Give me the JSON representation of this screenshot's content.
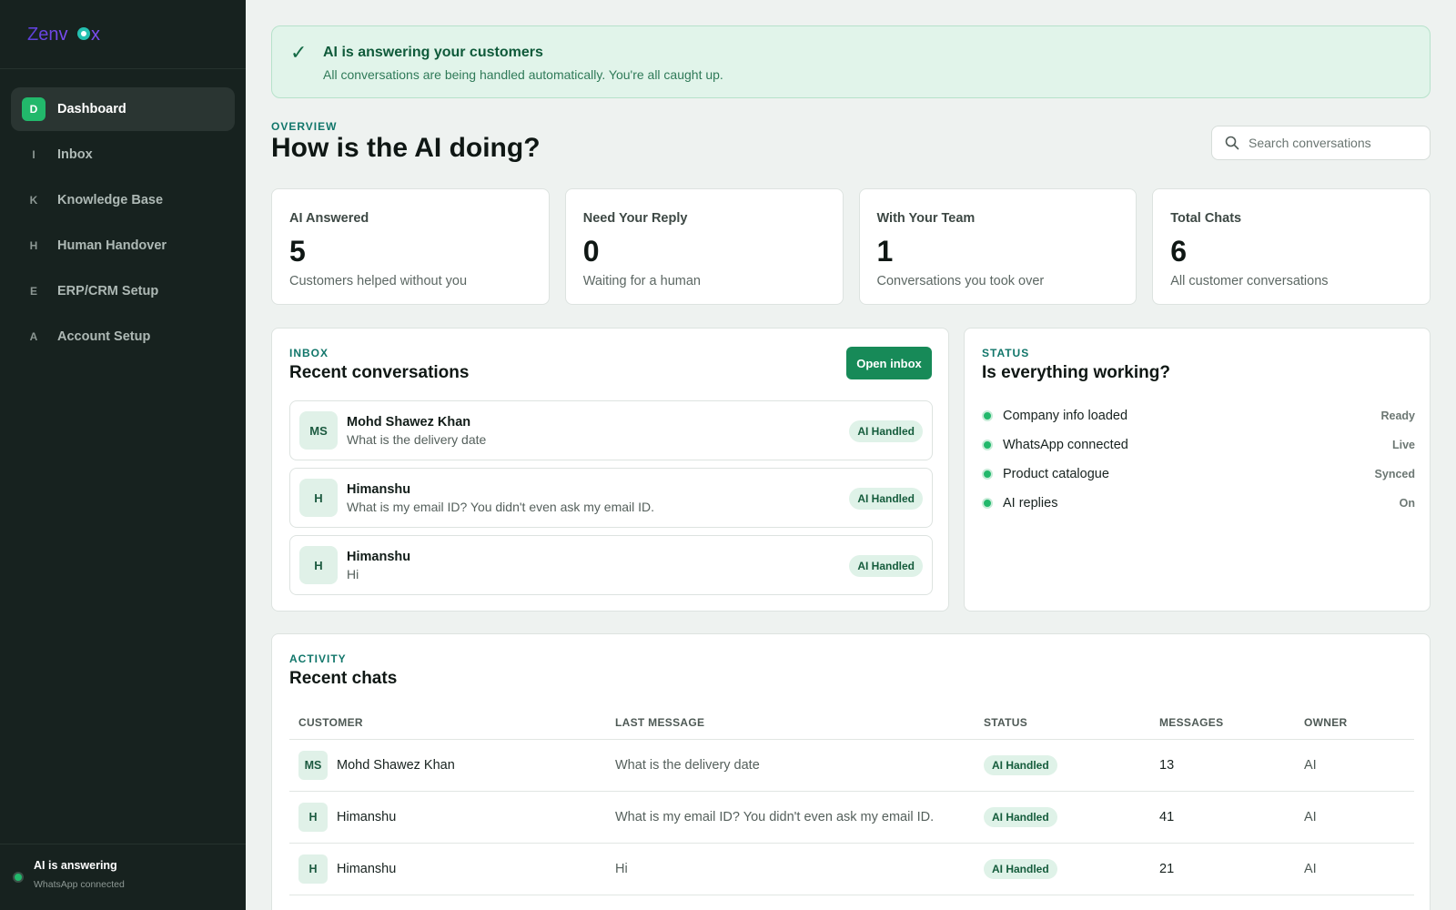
{
  "brand": {
    "name": "Zenvox"
  },
  "sidebar": {
    "items": [
      {
        "badge": "D",
        "label": "Dashboard",
        "active": true
      },
      {
        "badge": "I",
        "label": "Inbox"
      },
      {
        "badge": "K",
        "label": "Knowledge Base"
      },
      {
        "badge": "H",
        "label": "Human Handover"
      },
      {
        "badge": "E",
        "label": "ERP/CRM Setup"
      },
      {
        "badge": "A",
        "label": "Account Setup"
      }
    ],
    "footer": {
      "title": "AI is answering",
      "subtitle": "WhatsApp connected"
    }
  },
  "banner": {
    "icon": "✓",
    "title": "AI is answering your customers",
    "subtitle": "All conversations are being handled automatically. You're all caught up."
  },
  "overview": {
    "eyebrow": "OVERVIEW",
    "title": "How is the AI doing?"
  },
  "search": {
    "placeholder": "Search conversations"
  },
  "stats": [
    {
      "label": "AI Answered",
      "value": "5",
      "desc": "Customers helped without you"
    },
    {
      "label": "Need Your Reply",
      "value": "0",
      "desc": "Waiting for a human"
    },
    {
      "label": "With Your Team",
      "value": "1",
      "desc": "Conversations you took over"
    },
    {
      "label": "Total Chats",
      "value": "6",
      "desc": "All customer conversations"
    }
  ],
  "inbox": {
    "eyebrow": "INBOX",
    "title": "Recent conversations",
    "button": "Open inbox",
    "conversations": [
      {
        "initials": "MS",
        "name": "Mohd Shawez Khan",
        "message": "What is the delivery date",
        "status": "AI Handled"
      },
      {
        "initials": "H",
        "name": "Himanshu",
        "message": "What is my email ID? You didn't even ask my email ID.",
        "status": "AI Handled"
      },
      {
        "initials": "H",
        "name": "Himanshu",
        "message": "Hi",
        "status": "AI Handled"
      }
    ]
  },
  "status": {
    "eyebrow": "STATUS",
    "title": "Is everything working?",
    "items": [
      {
        "label": "Company info loaded",
        "value": "Ready"
      },
      {
        "label": "WhatsApp connected",
        "value": "Live"
      },
      {
        "label": "Product catalogue",
        "value": "Synced"
      },
      {
        "label": "AI replies",
        "value": "On"
      }
    ]
  },
  "activity": {
    "eyebrow": "ACTIVITY",
    "title": "Recent chats",
    "columns": [
      "CUSTOMER",
      "LAST MESSAGE",
      "STATUS",
      "MESSAGES",
      "OWNER"
    ],
    "rows": [
      {
        "initials": "MS",
        "customer": "Mohd Shawez Khan",
        "last_message": "What is the delivery date",
        "status": "AI Handled",
        "messages": "13",
        "owner": "AI"
      },
      {
        "initials": "H",
        "customer": "Himanshu",
        "last_message": "What is my email ID? You didn't even ask my email ID.",
        "status": "AI Handled",
        "messages": "41",
        "owner": "AI"
      },
      {
        "initials": "H",
        "customer": "Himanshu",
        "last_message": "Hi",
        "status": "AI Handled",
        "messages": "21",
        "owner": "AI"
      }
    ]
  },
  "colors": {
    "accent": "#22b86b",
    "sidebar_bg": "#17221f",
    "primary_button": "#178a58",
    "eyebrow": "#11766a"
  }
}
